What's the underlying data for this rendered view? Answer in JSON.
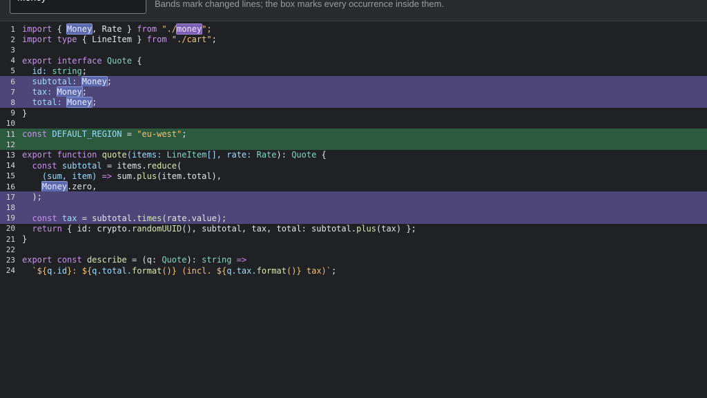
{
  "search": {
    "value": "Money"
  },
  "hint": "Bands mark changed lines; the box marks every occurrence inside them.",
  "colors": {
    "changed_band": "#4e4678",
    "added_band": "#2b5a3e",
    "occurrence": "#5d6ab0"
  },
  "editor": {
    "line_numbers": [
      "1",
      "2",
      "3",
      "4",
      "5",
      "6",
      "7",
      "8",
      "9",
      "10",
      "11",
      "12",
      "13",
      "14",
      "15",
      "16",
      "17",
      "18",
      "19",
      "20",
      "21",
      "22",
      "23",
      "24"
    ],
    "tokens": {
      "l1": [
        "import",
        " { ",
        "Money",
        ", Rate } ",
        "from",
        " \"./",
        "money",
        "\";"
      ],
      "l2": [
        "import",
        " ",
        "type",
        " { LineItem } ",
        "from",
        " \"./cart\"",
        ";"
      ],
      "l4": [
        "export",
        " ",
        "interface",
        " ",
        "Quote",
        " {"
      ],
      "l5": [
        "  id: ",
        "string",
        ";"
      ],
      "l6": [
        "  subtotal: ",
        "Money",
        ";"
      ],
      "l7": [
        "  tax: ",
        "Money",
        ";"
      ],
      "l8": [
        "  total: ",
        "Money",
        ";"
      ],
      "l9": [
        "}"
      ],
      "l11": [
        "const",
        " ",
        "DEFAULT_REGION",
        " = ",
        "\"eu-west\"",
        ";"
      ],
      "l13": [
        "export",
        " ",
        "function",
        " ",
        "quote",
        "(items: ",
        "LineItem",
        "[], rate: ",
        "Rate",
        "): ",
        "Quote",
        " {"
      ],
      "l14": [
        "  ",
        "const",
        " ",
        "subtotal",
        " = items.",
        "reduce",
        "("
      ],
      "l15": [
        "    (sum, item) ",
        "=>",
        " sum.",
        "plus",
        "(item.total),"
      ],
      "l16": [
        "    ",
        "Money",
        ".zero,"
      ],
      "l17": [
        "  );"
      ],
      "l19": [
        "  ",
        "const",
        " ",
        "tax",
        " = subtotal.",
        "times",
        "(rate.value);"
      ],
      "l20": [
        "  ",
        "return",
        " { id: crypto.",
        "randomUUID",
        "(), subtotal, tax, total: subtotal.",
        "plus",
        "(tax) };"
      ],
      "l21": [
        "}"
      ],
      "l23": [
        "export",
        " ",
        "const",
        " ",
        "describe",
        " = (q: ",
        "Quote",
        "): ",
        "string",
        " ",
        "=>"
      ],
      "l24": [
        "  ",
        "`${",
        "q.id",
        "}: ${",
        "q.total.",
        "format",
        "()} (incl. ${",
        "q.tax.",
        "format",
        "()} tax)`",
        ";"
      ]
    }
  }
}
